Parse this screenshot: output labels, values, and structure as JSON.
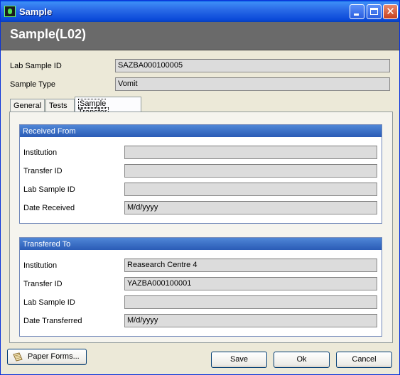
{
  "window": {
    "title": "Sample"
  },
  "header": {
    "title": "Sample(L02)"
  },
  "sample": {
    "lab_sample_id_label": "Lab Sample ID",
    "lab_sample_id_value": "SAZBA000100005",
    "sample_type_label": "Sample Type",
    "sample_type_value": "Vomit"
  },
  "tabs": [
    {
      "label": "General",
      "active": false
    },
    {
      "label": "Tests",
      "active": false
    },
    {
      "label": "Sample Transfer",
      "active": true
    }
  ],
  "received_from": {
    "heading": "Received From",
    "rows": [
      {
        "label": "Institution",
        "value": ""
      },
      {
        "label": "Transfer ID",
        "value": ""
      },
      {
        "label": "Lab Sample ID",
        "value": ""
      },
      {
        "label": "Date Received",
        "value": "M/d/yyyy"
      }
    ]
  },
  "transfered_to": {
    "heading": "Transfered To",
    "rows": [
      {
        "label": "Institution",
        "value": "Reasearch Centre 4"
      },
      {
        "label": "Transfer ID",
        "value": "YAZBA000100001"
      },
      {
        "label": "Lab Sample ID",
        "value": ""
      },
      {
        "label": "Date Transferred",
        "value": "M/d/yyyy"
      }
    ]
  },
  "buttons": {
    "paper_forms": "Paper Forms...",
    "save": "Save",
    "ok": "Ok",
    "cancel": "Cancel"
  },
  "icons": {
    "app": "biohazard-app-icon",
    "paper_forms": "paper-form-icon"
  }
}
